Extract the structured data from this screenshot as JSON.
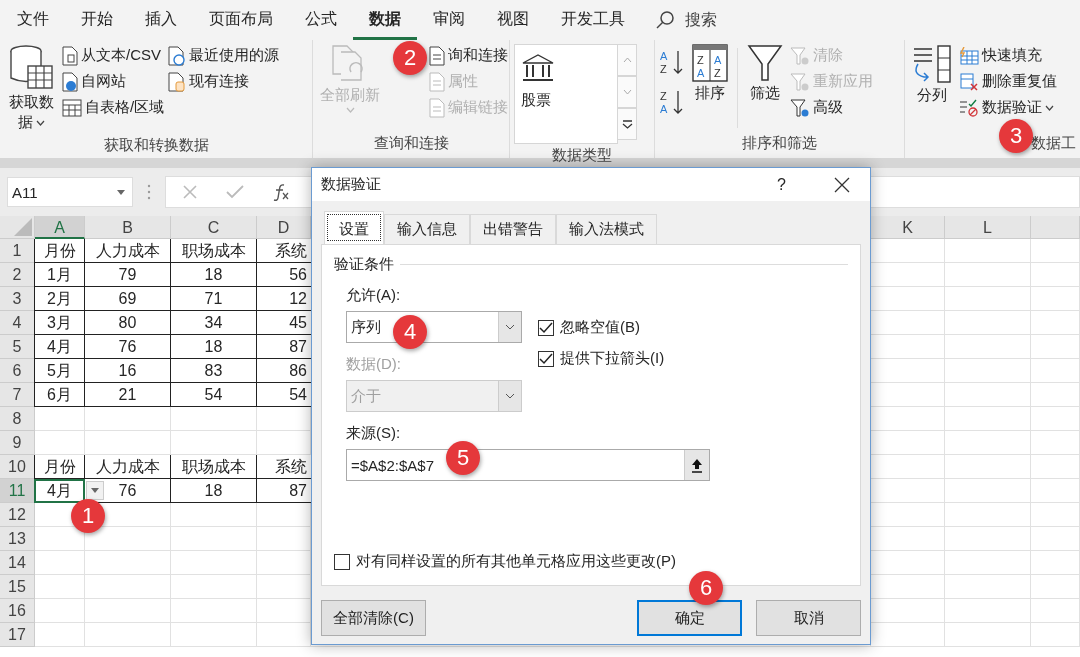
{
  "ribbon_tabs": [
    {
      "label": "文件",
      "selected": false
    },
    {
      "label": "开始",
      "selected": false
    },
    {
      "label": "插入",
      "selected": false
    },
    {
      "label": "页面布局",
      "selected": false
    },
    {
      "label": "公式",
      "selected": false
    },
    {
      "label": "数据",
      "selected": true
    },
    {
      "label": "审阅",
      "selected": false
    },
    {
      "label": "视图",
      "selected": false
    },
    {
      "label": "开发工具",
      "selected": false
    }
  ],
  "search": {
    "label": "搜索"
  },
  "ribbon": {
    "get_data": {
      "title": "获取和转换数据",
      "main": {
        "label": "获取数据",
        "dropdown": true
      },
      "items": [
        {
          "label": "从文本/CSV"
        },
        {
          "label": "自网站"
        },
        {
          "label": "自表格/区域"
        },
        {
          "label": "最近使用的源"
        },
        {
          "label": "现有连接"
        }
      ]
    },
    "queries": {
      "title": "查询和连接",
      "main": {
        "label": "全部刷新",
        "disabled": true,
        "dropdown": true
      },
      "items": [
        {
          "label": "询和连接",
          "disabled": false
        },
        {
          "label": "属性",
          "disabled": true
        },
        {
          "label": "编辑链接",
          "disabled": true
        }
      ]
    },
    "data_types": {
      "title": "数据类型",
      "items": [
        {
          "label": "股票"
        }
      ]
    },
    "sort_filter": {
      "title": "排序和筛选",
      "ascending": {
        "glyphs": [
          "A",
          "Z"
        ]
      },
      "descending": {
        "glyphs": [
          "Z",
          "A"
        ]
      },
      "sort": {
        "label": "排序",
        "glyphs": [
          "Z",
          "A",
          "A",
          "Z"
        ]
      },
      "filter": {
        "label": "筛选"
      },
      "items": [
        {
          "label": "清除",
          "disabled": true
        },
        {
          "label": "重新应用",
          "disabled": true
        },
        {
          "label": "高级",
          "disabled": false
        }
      ]
    },
    "data_tools": {
      "title": "数据工",
      "split": {
        "label": "分列"
      },
      "items": [
        {
          "label": "快速填充",
          "dropdown": false
        },
        {
          "label": "删除重复值",
          "dropdown": false
        },
        {
          "label": "数据验证",
          "dropdown": true
        }
      ]
    }
  },
  "formula_bar": {
    "name_box": "A11"
  },
  "sheet": {
    "dropdown": true,
    "columns": [
      {
        "label": "A",
        "selected": true
      },
      {
        "label": "B",
        "selected": false
      },
      {
        "label": "C",
        "selected": false
      },
      {
        "label": "D",
        "selected": false
      },
      {
        "label": "K",
        "selected": false
      },
      {
        "label": "L",
        "selected": false
      }
    ],
    "rows": [
      {
        "number": "1",
        "selected": false,
        "boxed": true,
        "cells": [
          "月份",
          "人力成本",
          "职场成本",
          "系统"
        ]
      },
      {
        "number": "2",
        "selected": false,
        "boxed": true,
        "cells": [
          "1月",
          "79",
          "18",
          "56"
        ]
      },
      {
        "number": "3",
        "selected": false,
        "boxed": true,
        "cells": [
          "2月",
          "69",
          "71",
          "12"
        ]
      },
      {
        "number": "4",
        "selected": false,
        "boxed": true,
        "cells": [
          "3月",
          "80",
          "34",
          "45"
        ]
      },
      {
        "number": "5",
        "selected": false,
        "boxed": true,
        "cells": [
          "4月",
          "76",
          "18",
          "87"
        ]
      },
      {
        "number": "6",
        "selected": false,
        "boxed": true,
        "cells": [
          "5月",
          "16",
          "83",
          "86"
        ]
      },
      {
        "number": "7",
        "selected": false,
        "boxed": true,
        "cells": [
          "6月",
          "21",
          "54",
          "54"
        ]
      },
      {
        "number": "8",
        "selected": false,
        "boxed": false,
        "cells": []
      },
      {
        "number": "9",
        "selected": false,
        "boxed": false,
        "cells": []
      },
      {
        "number": "10",
        "selected": false,
        "boxed": true,
        "cells": [
          "月份",
          "人力成本",
          "职场成本",
          "系统"
        ]
      },
      {
        "number": "11",
        "selected": true,
        "boxed": true,
        "cells": [
          "4月",
          "76",
          "18",
          "87"
        ]
      },
      {
        "number": "12",
        "selected": false,
        "boxed": false,
        "cells": []
      },
      {
        "number": "13",
        "selected": false,
        "boxed": false,
        "cells": []
      },
      {
        "number": "14",
        "selected": false,
        "boxed": false,
        "cells": []
      },
      {
        "number": "15",
        "selected": false,
        "boxed": false,
        "cells": []
      },
      {
        "number": "16",
        "selected": false,
        "boxed": false,
        "cells": []
      },
      {
        "number": "17",
        "selected": false,
        "boxed": false,
        "cells": []
      }
    ]
  },
  "dialog": {
    "title": "数据验证",
    "help": "?",
    "tabs": [
      {
        "label": "设置",
        "selected": true
      },
      {
        "label": "输入信息",
        "selected": false
      },
      {
        "label": "出错警告",
        "selected": false
      },
      {
        "label": "输入法模式",
        "selected": false
      }
    ],
    "section": "验证条件",
    "allow": {
      "label": "允许(A):",
      "value": "序列",
      "disabled": false
    },
    "data": {
      "label": "数据(D):",
      "value": "介于",
      "disabled": true
    },
    "options": [
      {
        "label": "忽略空值(B)",
        "checked": true
      },
      {
        "label": "提供下拉箭头(I)",
        "checked": true
      }
    ],
    "source": {
      "label": "来源(S):",
      "value": "=$A$2:$A$7"
    },
    "apply_all": {
      "label": "对有同样设置的所有其他单元格应用这些更改(P)",
      "checked": false
    },
    "buttons": [
      {
        "label": "全部清除(C)",
        "default": false
      },
      {
        "label": "确定",
        "default": true
      },
      {
        "label": "取消",
        "default": false
      }
    ]
  },
  "callouts": [
    "1",
    "2",
    "3",
    "4",
    "5",
    "6"
  ]
}
